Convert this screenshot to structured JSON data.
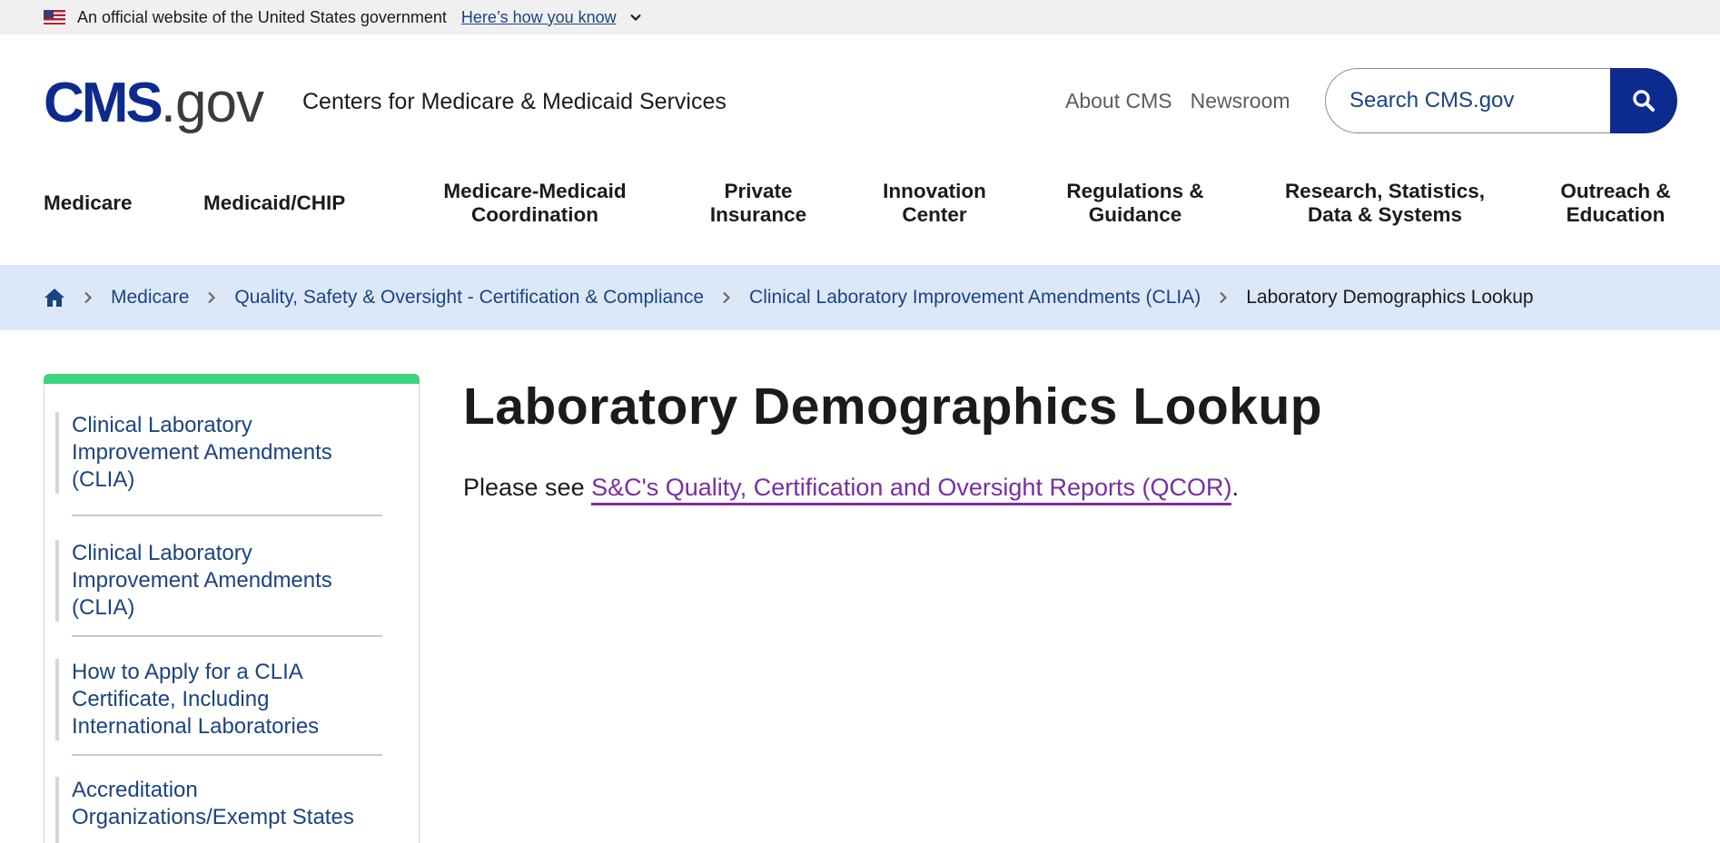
{
  "gov_banner": {
    "text": "An official website of the United States government",
    "link": "Here’s how you know"
  },
  "header": {
    "logo_cms": "CMS",
    "logo_gov": ".gov",
    "agency": "Centers for Medicare & Medicaid Services",
    "util_links": [
      "About CMS",
      "Newsroom"
    ],
    "search_placeholder": "Search CMS.gov"
  },
  "nav": {
    "items": [
      "Medicare",
      "Medicaid/CHIP",
      "Medicare-Medicaid Coordination",
      "Private Insurance",
      "Innovation Center",
      "Regulations & Guidance",
      "Research, Statistics, Data & Systems",
      "Outreach & Education"
    ]
  },
  "breadcrumb": {
    "links": [
      "Medicare",
      "Quality, Safety & Oversight - Certification & Compliance",
      "Clinical Laboratory Improvement Amendments (CLIA)"
    ],
    "current": "Laboratory Demographics Lookup"
  },
  "sidebar": {
    "items": [
      "Clinical Laboratory Improvement Amendments (CLIA)",
      "Clinical Laboratory Improvement Amendments (CLIA)",
      "How to Apply for a CLIA Certificate, Including International Laboratories",
      "Accreditation Organizations/Exempt States"
    ]
  },
  "main": {
    "title": "Laboratory Demographics Lookup",
    "intro_prefix": "Please see ",
    "intro_link": "S&C's Quality, Certification and Oversight Reports (QCOR)",
    "intro_suffix": "."
  },
  "colors": {
    "brand_blue": "#0d2b8f",
    "link_blue": "#1a4480",
    "visited_purple": "#7a2e9f",
    "breadcrumb_bg": "#dce8f8",
    "sidebar_accent": "#3cd37f"
  }
}
